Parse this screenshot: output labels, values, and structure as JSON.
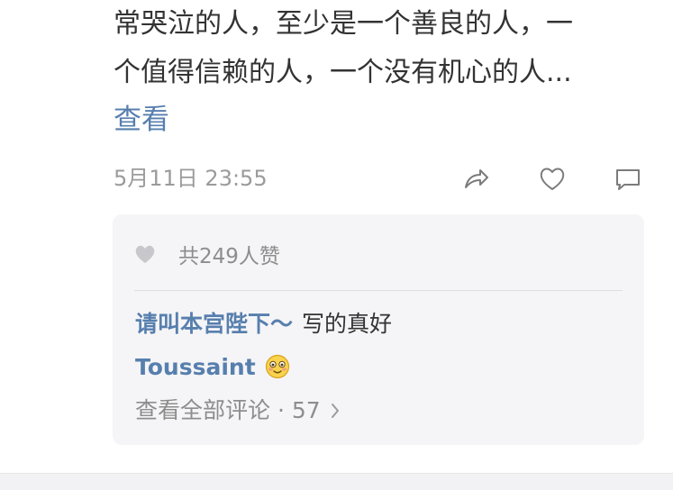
{
  "post": {
    "text_lines": [
      "常哭泣的人，至少是一个善良的人，一",
      "个值得信赖的人，一个没有机心的人..."
    ],
    "view_more": "查看",
    "timestamp": "5月11日 23:55"
  },
  "actions": {
    "share_icon": "share-icon",
    "like_icon": "heart-outline-icon",
    "comment_icon": "comment-icon"
  },
  "comments": {
    "likes_summary": "共249人赞",
    "items": [
      {
        "author": "请叫本宫陛下～",
        "text": "写的真好"
      },
      {
        "author": "Toussaint",
        "emoji": "blushing-smile-emoji"
      }
    ],
    "view_all": "查看全部评论 · 57"
  },
  "colors": {
    "link": "#577fae",
    "text": "#333333",
    "muted": "#9b9b9b",
    "card_bg": "#f5f5f7"
  }
}
